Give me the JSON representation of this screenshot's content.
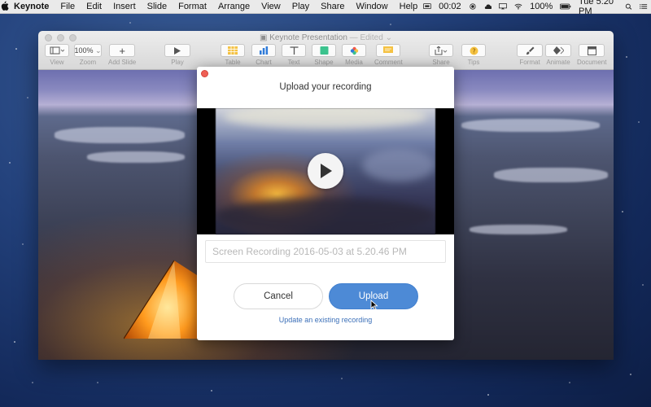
{
  "menubar": {
    "app_name": "Keynote",
    "items": [
      "File",
      "Edit",
      "Insert",
      "Slide",
      "Format",
      "Arrange",
      "View",
      "Play",
      "Share",
      "Window",
      "Help"
    ],
    "timer": "00:02",
    "battery": "100%",
    "clock": "Tue 5:20 PM"
  },
  "window": {
    "title": "Keynote Presentation",
    "edited": "— Edited ⌄",
    "toolbar": {
      "view": "View",
      "zoom_value": "100%",
      "zoom": "Zoom",
      "add_slide": "Add Slide",
      "play": "Play",
      "table": "Table",
      "chart": "Chart",
      "text": "Text",
      "shape": "Shape",
      "media": "Media",
      "comment": "Comment",
      "share": "Share",
      "tips": "Tips",
      "format": "Format",
      "animate": "Animate",
      "document": "Document"
    }
  },
  "modal": {
    "title": "Upload your recording",
    "name_placeholder": "Screen Recording 2016-05-03 at 5.20.46 PM",
    "cancel_label": "Cancel",
    "upload_label": "Upload",
    "update_link": "Update an existing recording"
  },
  "icons": [
    "apple-icon",
    "play-icon",
    "wifi-icon",
    "battery-icon",
    "search-icon",
    "list-icon",
    "photo-icon",
    "cursor-icon"
  ],
  "colors": {
    "accent": "#4d8ad6",
    "link": "#3b6fb8",
    "close": "#ef5f55"
  }
}
